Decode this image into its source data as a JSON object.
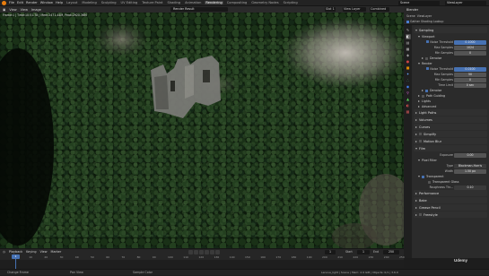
{
  "topbar": {
    "menus": [
      "File",
      "Edit",
      "Render",
      "Window",
      "Help"
    ],
    "workspaces": [
      "Layout",
      "Modeling",
      "Sculpting",
      "UV Editing",
      "Texture Paint",
      "Shading",
      "Animation",
      "Rendering",
      "Compositing",
      "Geometry Nodes",
      "Scripting"
    ],
    "active_workspace": "Rendering",
    "scene": "Scene",
    "view_layer": "ViewLayer"
  },
  "image_editor": {
    "menus": [
      "View",
      "View",
      "Image"
    ],
    "image_name": "Render Result",
    "slot": "Slot 1",
    "layer": "View Layer",
    "pass": "Combined",
    "status": "Frame:1 | Time:10:51.78 | Mem:2471.44M, Peak:2920.36M"
  },
  "outliner": {
    "scene_label": "Scene",
    "layer_label": "ViewLayer",
    "display": "Blender",
    "item": "Gather Shading Lookup"
  },
  "properties": {
    "sections": {
      "sampling": "Sampling",
      "viewport": "Viewport",
      "noise_threshold_label": "Noise Threshold",
      "noise_threshold_vp": "0.1000",
      "max_samples_label": "Max Samples",
      "max_samples_vp": "1024",
      "min_samples_label": "Min Samples",
      "min_samples_vp": "0",
      "denoise_vp": "Denoise",
      "render": "Render",
      "noise_threshold_r": "0.0100",
      "max_samples_r": "50",
      "min_samples_r": "0",
      "time_limit_label": "Time Limit",
      "time_limit": "0 sec",
      "denoise_r": "Denoise",
      "path_guiding": "Path Guiding",
      "lights": "Lights",
      "advanced": "Advanced",
      "light_paths": "Light Paths",
      "volumes": "Volumes",
      "curves": "Curves",
      "simplify": "Simplify",
      "motion_blur": "Motion Blur",
      "film": "Film",
      "exposure_label": "Exposure",
      "exposure": "0.00",
      "pixel_filter": "Pixel Filter",
      "type_label": "Type",
      "type_value": "Blackman-Harris",
      "width_label": "Width",
      "width_value": "1.50 px",
      "transparent": "Transparent",
      "transparent_glass": "Transparent Glass",
      "roughness_label": "Roughness Thr...",
      "roughness_value": "0.10",
      "performance": "Performance",
      "bake": "Bake",
      "grease_pencil": "Grease Pencil",
      "freestyle": "Freestyle"
    }
  },
  "timeline": {
    "menus": [
      "Playback",
      "Keying",
      "View",
      "Marker"
    ],
    "current_frame": "1",
    "start_label": "Start",
    "start": "1",
    "end_label": "End",
    "end": "250",
    "ticks": [
      "0",
      "10",
      "20",
      "30",
      "40",
      "50",
      "60",
      "70",
      "80",
      "90",
      "100",
      "110",
      "120",
      "130",
      "140",
      "150",
      "160",
      "170",
      "180",
      "190",
      "200",
      "210",
      "220",
      "230",
      "240",
      "250"
    ]
  },
  "statusbar": {
    "left": "Change Frame",
    "mid1": "Pan View",
    "mid2": "Sample Color",
    "right": "Lenova_light | Scene | Mem: 2.9 GiB | Objects: 0/1 | 3.6.0"
  },
  "watermark": "Udemy",
  "colors": {
    "accent": "#4772b3",
    "logo": "#e87d0d",
    "panel": "#2b2b2b"
  }
}
